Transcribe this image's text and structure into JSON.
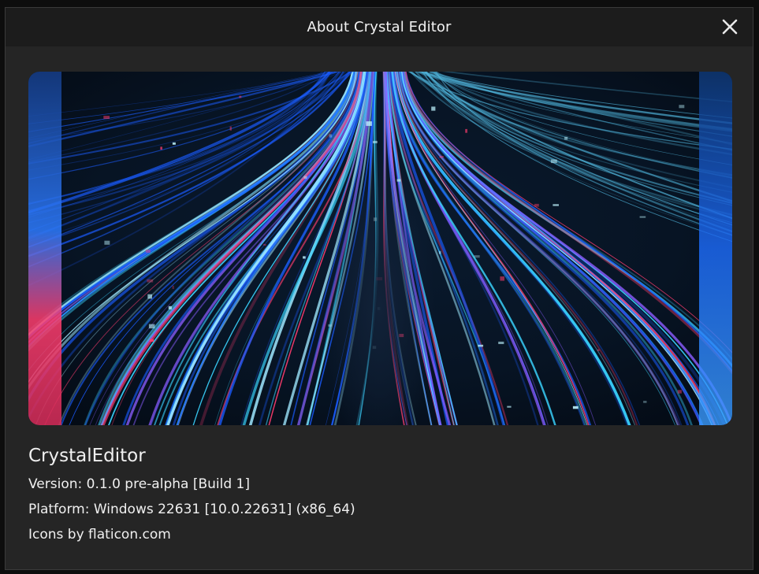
{
  "window": {
    "title": "About Crystal Editor",
    "close_icon": "close-icon"
  },
  "banner": {
    "image": "abstract-light-streaks-banner",
    "colors": {
      "background": "#06101c",
      "cyan": "#3ad4ff",
      "blue": "#1a5cff",
      "pink": "#ff3d6e",
      "violet": "#8a5cff"
    }
  },
  "about": {
    "app_name": "CrystalEditor",
    "version": "Version: 0.1.0 pre-alpha [Build 1]",
    "platform": "Platform: Windows 22631 [10.0.22631] (x86_64)",
    "credits": "Icons by flaticon.com"
  }
}
